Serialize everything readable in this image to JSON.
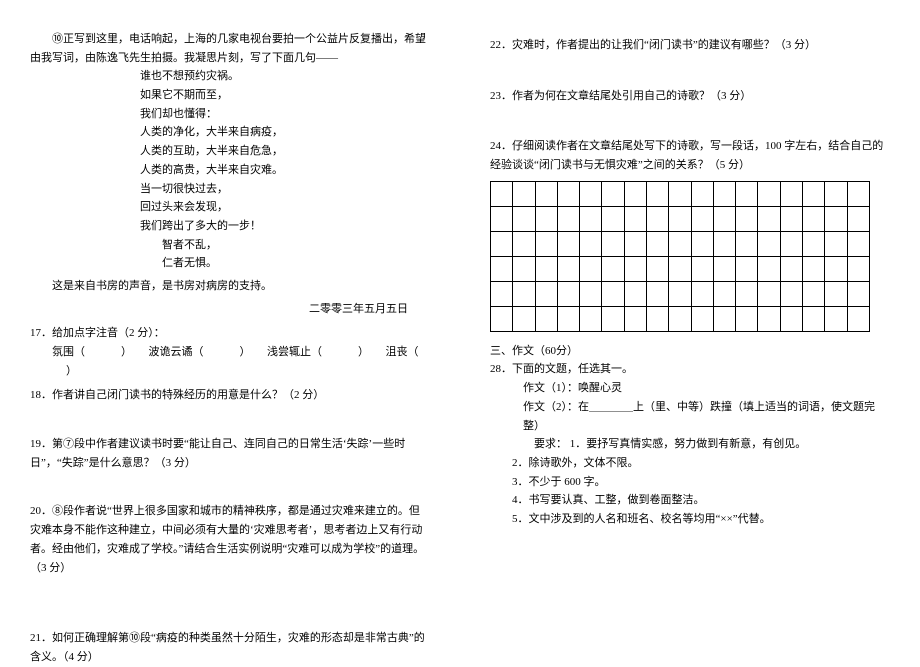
{
  "left": {
    "intro": "⑩正写到这里，电话响起，上海的几家电视台要拍一个公益片反复播出，希望由我写词，由陈逸飞先生拍摄。我凝思片刻，写了下面几句——",
    "poem": [
      "谁也不想预约灾祸。",
      "如果它不期而至，",
      "我们却也懂得：",
      "人类的净化，大半来自病疫，",
      "人类的互助，大半来自危急，",
      "人类的高贵，大半来自灾难。",
      "当一切很快过去，",
      "回过头来会发现，",
      "我们跨出了多大的一步！",
      "　　智者不乱，",
      "　　仁者无惧。"
    ],
    "closing": "这是来自书房的声音，是书房对病房的支持。",
    "date": "二零零三年五月五日",
    "q17_head": "17．给加点字注音（2 分）：",
    "q17_body_a": "氛围（",
    "q17_body_b": "）　　波诡云谲（",
    "q17_body_c": "）　　浅尝辄止（",
    "q17_body_d": "）　　沮丧（",
    "q17_body_e": "）",
    "q18": "18．作者讲自己闭门读书的特殊经历的用意是什么？（2 分）",
    "q19": "19．第⑦段中作者建议读书时要“能让自己、连同自己的日常生活‘失踪’一些时日”，“失踪”是什么意思？（3 分）",
    "q20": "20．⑧段作者说“世界上很多国家和城市的精神秩序，都是通过灾难来建立的。但灾难本身不能作这种建立，中间必须有大量的‘灾难思考者’，思考者边上又有行动者。经由他们，灾难成了学校。”请结合生活实例说明“灾难可以成为学校”的道理。（3 分）",
    "q21": "21．如何正确理解第⑩段“病疫的种类虽然十分陌生，灾难的形态却是非常古典”的含义。（4 分）"
  },
  "right": {
    "q22": "22．灾难时，作者提出的让我们“闭门读书”的建议有哪些？（3 分）",
    "q23": "23．作者为何在文章结尾处引用自己的诗歌？（3 分）",
    "q24": "24．仔细阅读作者在文章结尾处写下的诗歌，写一段话，100 字左右，结合自己的经验谈谈“闭门读书与无惧灾难”之间的关系？（5 分）",
    "grid_cols": 17,
    "grid_rows": 6,
    "sec3_title": "三、作文（60分）",
    "q28_head": "28．下面的文题，任选其一。",
    "essay1": "作文（1）：唤醒心灵",
    "essay2_a": "作文（2）：在＿＿＿＿上（里、中等）跌撞（填上适当的词语，使文题完整）",
    "req_label": "要求：",
    "req_items": [
      "1．要抒写真情实感，努力做到有新意，有创见。",
      "2．除诗歌外，文体不限。",
      "3．不少于 600 字。",
      "4．书写要认真、工整，做到卷面整洁。",
      "5．文中涉及到的人名和班名、校名等均用“××”代替。"
    ]
  }
}
